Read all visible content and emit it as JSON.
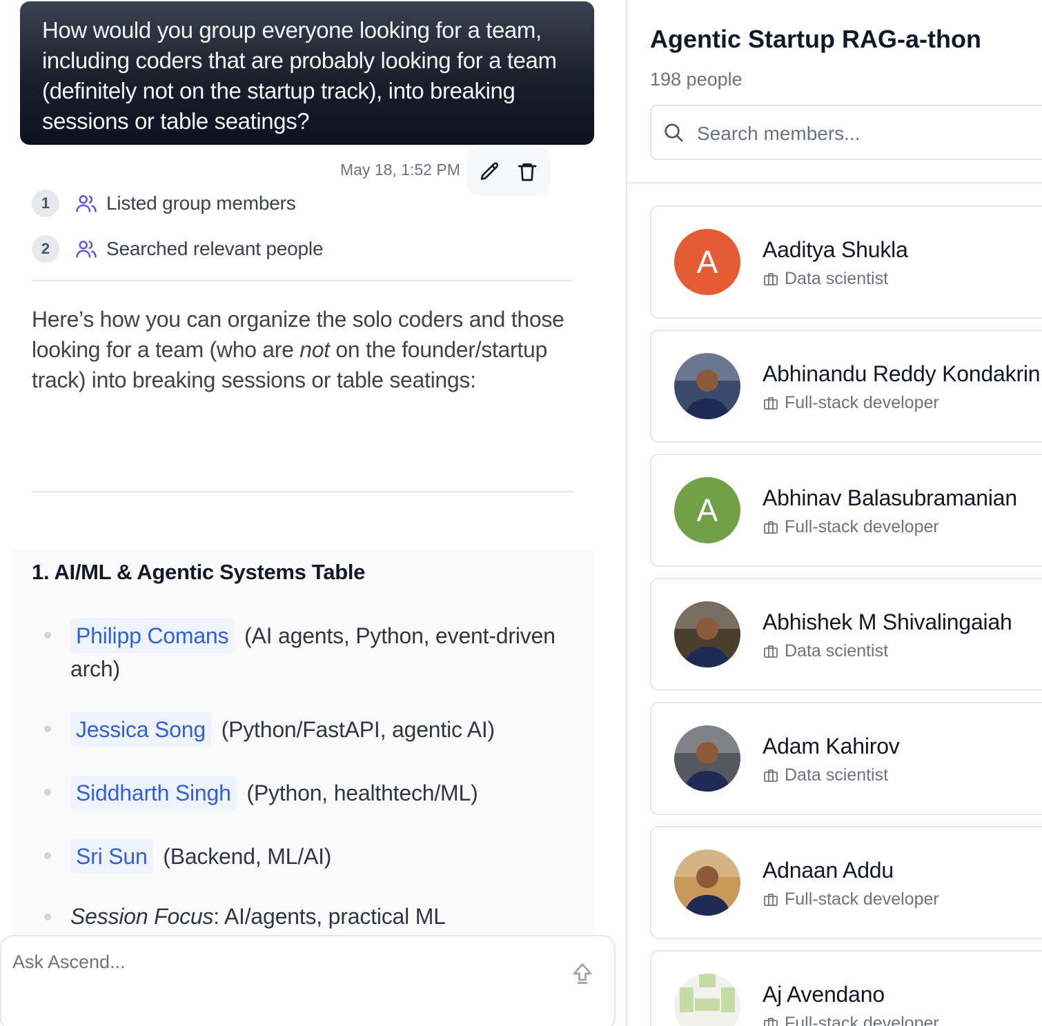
{
  "chat": {
    "user_message": "How would you group everyone looking for a team, including coders that are probably looking for a team (definitely not on the startup track), into breaking sessions or table seatings?",
    "timestamp": "May 18, 1:52 PM",
    "steps": [
      {
        "num": "1",
        "icon": "users-icon",
        "label": "Listed group members"
      },
      {
        "num": "2",
        "icon": "users-icon",
        "label": "Searched relevant people"
      }
    ],
    "intro_before": "Here’s how you can organize the solo coders and those looking for a team (who are ",
    "intro_emph": "not",
    "intro_after": " on the founder/startup track) into breaking sessions or table seatings:",
    "section": {
      "title": "1. AI/ML & Agentic Systems Table",
      "items": [
        {
          "name": "Philipp Comans",
          "desc": " (AI agents, Python, event-driven arch)"
        },
        {
          "name": "Jessica Song",
          "desc": " (Python/FastAPI, agentic AI)"
        },
        {
          "name": "Siddharth Singh",
          "desc": " (Python, healthtech/ML)"
        },
        {
          "name": "Sri Sun",
          "desc": " (Backend, ML/AI)"
        }
      ],
      "focus_label": "Session Focus",
      "focus_text": ": AI/agents, practical ML"
    },
    "composer_placeholder": "Ask Ascend..."
  },
  "members": {
    "event_title": "Agentic Startup RAG-a-thon",
    "people_count": "198 people",
    "search_placeholder": "Search members...",
    "list": [
      {
        "name": "Aaditya Shukla",
        "role": "Data scientist",
        "initial": "A",
        "avatar_color": "#e45c35",
        "avatar": "initial"
      },
      {
        "name": "Abhinandu Reddy Kondakrin",
        "role": "Full-stack developer",
        "initial": "",
        "avatar_color": "#3b4a6b",
        "avatar": "photo"
      },
      {
        "name": "Abhinav Balasubramanian",
        "role": "Full-stack developer",
        "initial": "A",
        "avatar_color": "#71a046",
        "avatar": "initial"
      },
      {
        "name": "Abhishek M Shivalingaiah",
        "role": "Data scientist",
        "initial": "",
        "avatar_color": "#4a3e2c",
        "avatar": "photo"
      },
      {
        "name": "Adam Kahirov",
        "role": "Data scientist",
        "initial": "",
        "avatar_color": "#55585e",
        "avatar": "photo"
      },
      {
        "name": "Adnaan Addu",
        "role": "Full-stack developer",
        "initial": "",
        "avatar_color": "#c89a5a",
        "avatar": "photo"
      },
      {
        "name": "Aj Avendano",
        "role": "Full-stack developer",
        "initial": "",
        "avatar_color": "#c6dca4",
        "avatar": "identicon"
      }
    ]
  },
  "colors": {
    "link": "#2f62d8",
    "chip_bg": "#eef3fd",
    "step_icon": "#5b5be0"
  }
}
